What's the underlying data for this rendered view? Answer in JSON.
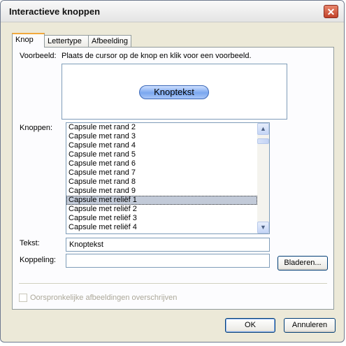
{
  "window": {
    "title": "Interactieve knoppen",
    "close_glyph": "✕"
  },
  "tabs": [
    {
      "label": "Knop",
      "active": true
    },
    {
      "label": "Lettertype",
      "active": false
    },
    {
      "label": "Afbeelding",
      "active": false
    }
  ],
  "preview": {
    "label": "Voorbeeld:",
    "hint": "Plaats de cursor op de knop en klik voor een voorbeeld.",
    "button_text": "Knoptekst"
  },
  "buttons_list": {
    "label": "Knoppen:",
    "items": [
      "Capsule met rand 2",
      "Capsule met rand 3",
      "Capsule met rand 4",
      "Capsule met rand 5",
      "Capsule met rand 6",
      "Capsule met rand 7",
      "Capsule met rand 8",
      "Capsule met rand 9",
      "Capsule met reliëf 1",
      "Capsule met reliëf 2",
      "Capsule met reliëf 3",
      "Capsule met reliëf 4"
    ],
    "selected_index": 8,
    "scroll_up_glyph": "▲",
    "scroll_down_glyph": "▼"
  },
  "text_field": {
    "label": "Tekst:",
    "value": "Knoptekst"
  },
  "link_field": {
    "label": "Koppeling:",
    "value": ""
  },
  "browse_button": "Bladeren...",
  "overwrite_checkbox": {
    "label": "Oorspronkelijke afbeeldingen overschrijven",
    "checked": false,
    "enabled": false
  },
  "footer": {
    "ok": "OK",
    "cancel": "Annuleren"
  },
  "colors": {
    "selected_row": "#c2cad8",
    "capsule": "#7aa7ef",
    "close_button": "#c1422a"
  }
}
